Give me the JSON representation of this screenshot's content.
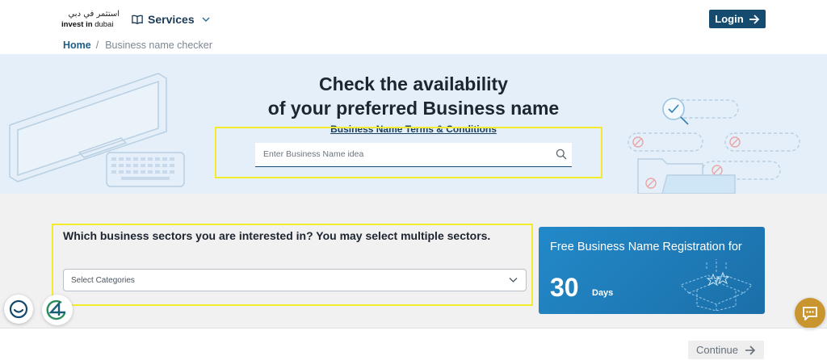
{
  "header": {
    "logo_ar": "استثمر في دبي",
    "logo_en_bold": "invest in",
    "logo_en_light": "dubai",
    "services_label": "Services",
    "login_label": "Login"
  },
  "breadcrumb": {
    "home": "Home",
    "separator": "/",
    "current": "Business name checker"
  },
  "hero": {
    "title_line1": "Check the availability",
    "title_line2": "of your preferred Business name",
    "terms_link": "Business Name Terms & Conditions",
    "search_placeholder": "Enter Business Name idea"
  },
  "sectors": {
    "question": "Which business sectors you are interested in? You may select multiple sectors.",
    "select_placeholder": "Select Categories"
  },
  "promo": {
    "title": "Free Business Name Registration for",
    "number": "30",
    "unit": "Days"
  },
  "footer": {
    "continue_label": "Continue"
  },
  "colors": {
    "brand_navy": "#144b6f",
    "hero_bg": "#e4eff9",
    "promo_blue": "#2389c9",
    "highlight_yellow": "#f4ec2a",
    "chat_gold": "#c9952f"
  },
  "icons": [
    "book-icon",
    "chevron-down-icon",
    "arrow-right-icon",
    "search-icon",
    "chat-bot-icon",
    "g4-icon",
    "message-icon"
  ]
}
